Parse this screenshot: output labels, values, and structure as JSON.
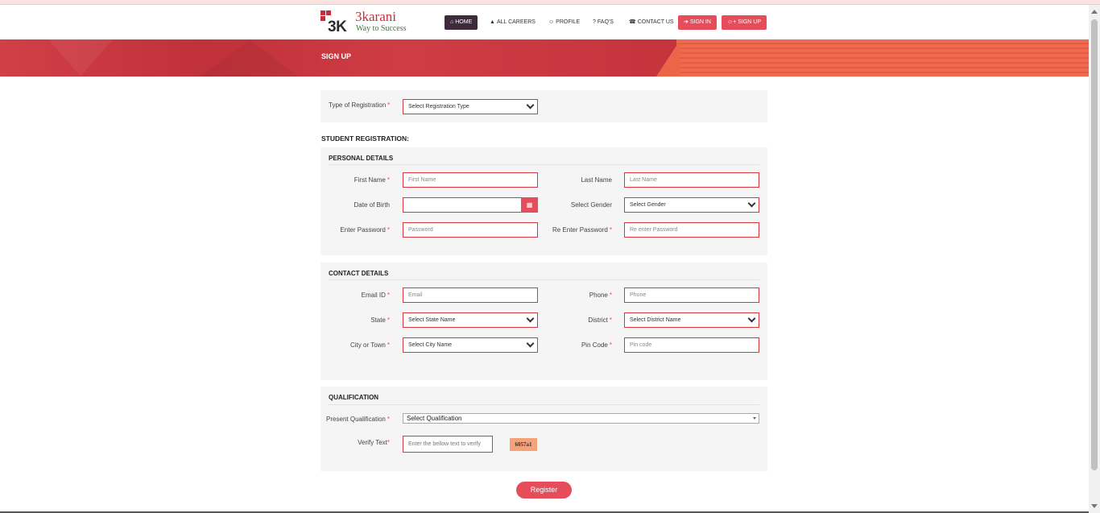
{
  "brand": {
    "mark": "3K",
    "name": "3karani",
    "tagline": "Way to Success"
  },
  "nav": [
    {
      "label": "HOME",
      "icon": "home-icon",
      "glyph": "⌂"
    },
    {
      "label": "ALL CAREERS",
      "icon": "graduation-cap-icon",
      "glyph": "▲"
    },
    {
      "label": "PROFILE",
      "icon": "user-icon",
      "glyph": "☺"
    },
    {
      "label": "FAQ'S",
      "icon": "question-icon",
      "glyph": "?"
    },
    {
      "label": "CONTACT US",
      "icon": "phone-icon",
      "glyph": "☎"
    },
    {
      "label": "SIGN IN",
      "icon": "sign-in-icon",
      "glyph": "➜"
    },
    {
      "label": "SIGN UP",
      "icon": "user-plus-icon",
      "glyph": "☺+"
    }
  ],
  "banner_title": "SIGN UP",
  "registration_type": {
    "label": "Type of Registration",
    "value": "Select Registration Type"
  },
  "section_heading": "STUDENT REGISTRATION:",
  "personal": {
    "heading": "PERSONAL DETAILS",
    "first_name": {
      "label": "First Name",
      "placeholder": "First Name"
    },
    "last_name": {
      "label": "Last Name",
      "placeholder": "Last Name"
    },
    "dob": {
      "label": "Date of Birth",
      "value": ""
    },
    "gender": {
      "label": "Select Gender",
      "value": "Select Gender"
    },
    "password": {
      "label": "Enter Password",
      "placeholder": "Password"
    },
    "repassword": {
      "label": "Re Enter Password",
      "placeholder": "Re enter Password"
    }
  },
  "contact": {
    "heading": "CONTACT DETAILS",
    "email": {
      "label": "Email ID",
      "placeholder": "Email"
    },
    "phone": {
      "label": "Phone",
      "placeholder": "Phone"
    },
    "state": {
      "label": "State",
      "value": "Select State Name"
    },
    "district": {
      "label": "District",
      "value": "Select District Name"
    },
    "city": {
      "label": "City or Town",
      "value": "Select City Name"
    },
    "pincode": {
      "label": "Pin Code",
      "placeholder": "Pin code"
    }
  },
  "qualification": {
    "heading": "QUALIFICATION",
    "present": {
      "label": "Present Qualification",
      "value": "Select Qualification"
    },
    "verify": {
      "label": "Verify Text",
      "placeholder": "Enter the bellow text to verify",
      "captcha": "6057a1"
    }
  },
  "register_label": "Register",
  "required_mark": "*",
  "colors": {
    "accent": "#e74c5a",
    "nav_active": "#3d2b3d",
    "banner": "#c8363f",
    "banner_right": "#ee6b4f"
  }
}
